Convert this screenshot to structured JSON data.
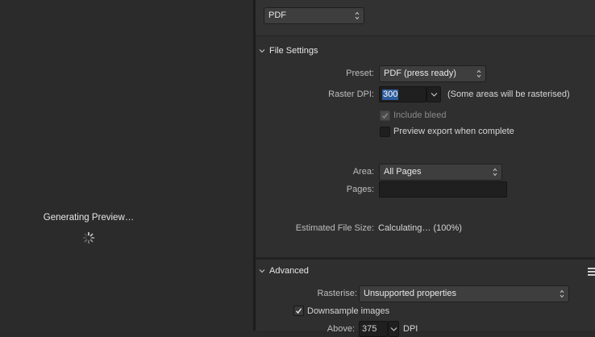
{
  "preview": {
    "status_text": "Generating Preview…"
  },
  "format": {
    "selected": "PDF"
  },
  "file_settings": {
    "title": "File Settings",
    "preset_label": "Preset:",
    "preset_value": "PDF (press ready)",
    "raster_dpi_label": "Raster DPI:",
    "raster_dpi_value": "300",
    "raster_dpi_note": "(Some areas will be rasterised)",
    "include_bleed_label": "Include bleed",
    "include_bleed_checked": true,
    "preview_export_label": "Preview export when complete",
    "preview_export_checked": false,
    "area_label": "Area:",
    "area_value": "All Pages",
    "pages_label": "Pages:",
    "pages_value": "",
    "estimated_size_label": "Estimated File Size:",
    "estimated_size_value": "Calculating… (100%)"
  },
  "advanced": {
    "title": "Advanced",
    "rasterise_label": "Rasterise:",
    "rasterise_value": "Unsupported properties",
    "downsample_label": "Downsample images",
    "downsample_checked": true,
    "above_label": "Above:",
    "above_value": "375",
    "above_unit": "DPI"
  },
  "icons": {
    "spinner": "loading-spinner-icon",
    "chevron": "chevron-down-icon",
    "menu": "hamburger-menu-icon",
    "check": "checkmark-icon"
  }
}
